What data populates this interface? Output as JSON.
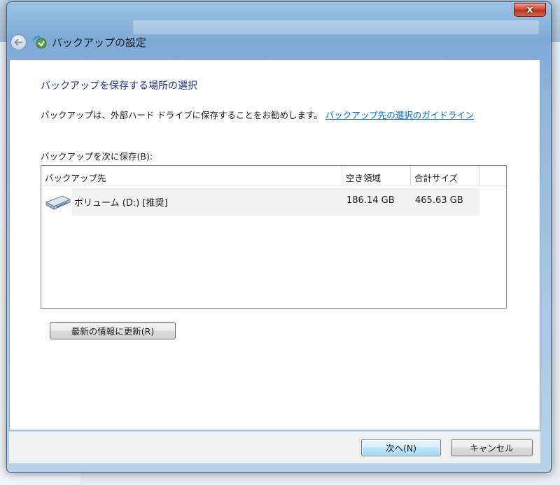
{
  "window": {
    "title": "バックアップの設定",
    "close_label": "x"
  },
  "page": {
    "heading": "バックアップを保存する場所の選択",
    "recommend_text": "バックアップは、外部ハード ドライブに保存することをお勧めします。",
    "guideline_link": "バックアップ先の選択のガイドライン",
    "save_label": "バックアップを次に保存(B):"
  },
  "listview": {
    "columns": [
      "バックアップ先",
      "空き領域",
      "合計サイズ"
    ],
    "rows": [
      {
        "name": "ボリューム (D:) [推奨]",
        "free": "186.14 GB",
        "total": "465.63 GB",
        "icon": "drive-icon"
      }
    ]
  },
  "buttons": {
    "refresh": "最新の情報に更新(R)",
    "next": "次へ(N)",
    "cancel": "キャンセル"
  },
  "colors": {
    "heading": "#1e3287",
    "link": "#0066cc",
    "selection": "#f2f2f2"
  }
}
